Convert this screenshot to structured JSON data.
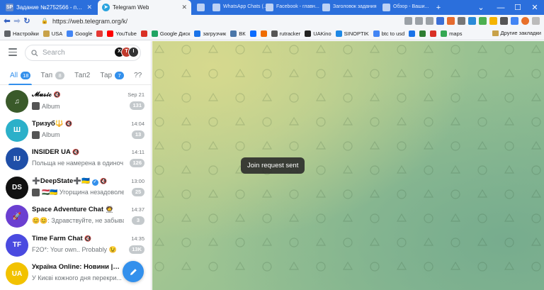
{
  "browser": {
    "tabs": [
      {
        "favicon_text": "SP",
        "title": "Задание №2752566 - просмотр з",
        "active": false
      },
      {
        "favicon_text": "",
        "title": "Telegram Web",
        "active": true
      }
    ],
    "background_tab_titles": [
      "WhatsApp Chats (...)",
      "Facebook - главн...",
      "Заголовок задания",
      "Обзор - Ваши..."
    ],
    "address": {
      "url": "https://web.telegram.org/k/"
    },
    "bookmarks": [
      {
        "label": "Настройки",
        "icon": "gear-icon",
        "color": "#5f6368"
      },
      {
        "label": "USA",
        "icon": "folder-icon",
        "color": "#c8a24a"
      },
      {
        "label": "Google",
        "icon": "google-icon",
        "color": "#4285f4"
      },
      {
        "label": "",
        "icon": "yandex-icon",
        "color": "#e53935"
      },
      {
        "label": "YouTube",
        "icon": "youtube-icon",
        "color": "#ff0000"
      },
      {
        "label": "",
        "icon": "gmail-icon",
        "color": "#d93025"
      },
      {
        "label": "Google Диск",
        "icon": "drive-icon",
        "color": "#1fa463"
      },
      {
        "label": "загрузчик",
        "icon": "download-icon",
        "color": "#1a73e8"
      },
      {
        "label": "ВК",
        "icon": "vk-icon",
        "color": "#4a76a8"
      },
      {
        "label": "",
        "icon": "mail-icon",
        "color": "#0a6cff"
      },
      {
        "label": "",
        "icon": "app-icon",
        "color": "#ef6c00"
      },
      {
        "label": "rutracker",
        "icon": "rutracker-icon",
        "color": "#555555"
      },
      {
        "label": "UAKino",
        "icon": "uakino-icon",
        "color": "#222222"
      },
      {
        "label": "SINOPTIK",
        "icon": "thermometer-icon",
        "color": "#1e88e5"
      },
      {
        "label": "btc to usd",
        "icon": "google-icon",
        "color": "#4285f4"
      },
      {
        "label": "",
        "icon": "p-icon",
        "color": "#1a73e8"
      },
      {
        "label": "",
        "icon": "shield-icon",
        "color": "#2e7d32"
      },
      {
        "label": "",
        "icon": "gmail-icon",
        "color": "#d93025"
      },
      {
        "label": "maps",
        "icon": "maps-icon",
        "color": "#34a853"
      }
    ],
    "other_bookmarks": "Другие закладки"
  },
  "telegram": {
    "search_placeholder": "Search",
    "folders": [
      {
        "label": "All",
        "count": "18",
        "active": true
      },
      {
        "label": "Тап",
        "count": "8",
        "active": false
      },
      {
        "label": "Тап2",
        "count": "",
        "active": false
      },
      {
        "label": "Тар",
        "count": "7",
        "active": false,
        "blue": true
      },
      {
        "label": "??",
        "count": "",
        "active": false
      }
    ],
    "chats": [
      {
        "name": "𝓜𝓾𝓼𝓲𝓬",
        "muted": true,
        "verified": false,
        "preview": "Album",
        "time": "Sep 21",
        "unread": "131",
        "avatar_color": "#3a5a2a",
        "avatar_text": "♫",
        "thumb": true
      },
      {
        "name": "Тризуб🔱",
        "muted": true,
        "verified": false,
        "preview": "Album",
        "time": "14:04",
        "unread": "13",
        "avatar_color": "#2bb0c9",
        "avatar_text": "Ш",
        "thumb": true
      },
      {
        "name": "INSIDER UA",
        "muted": true,
        "verified": false,
        "preview": "Польща не намерена в одиноч...",
        "time": "14:11",
        "unread": "126",
        "avatar_color": "#1f4fa8",
        "avatar_text": "IU",
        "thumb": false
      },
      {
        "name": "➕DeepState➕🇺🇦",
        "muted": true,
        "verified": true,
        "preview": "🇭🇺🇺🇦 Угорщина незадоволе...",
        "time": "13:00",
        "unread": "25",
        "avatar_color": "#111111",
        "avatar_text": "DS",
        "thumb": true
      },
      {
        "name": "Space Adventure Chat 🧑‍🚀",
        "muted": false,
        "verified": false,
        "preview": "😊😊: Здравствуйте, не забываем...",
        "time": "14:37",
        "unread": "3",
        "avatar_color": "#6b3fd1",
        "avatar_text": "🚀",
        "thumb": false
      },
      {
        "name": "Time Farm Chat",
        "muted": true,
        "verified": false,
        "preview": "F2O*: Your own.. Probably 😉",
        "time": "14:35",
        "unread": "13K",
        "avatar_color": "#4a4ae0",
        "avatar_text": "TF",
        "thumb": false
      },
      {
        "name": "Україна Online: Новини | ...",
        "muted": false,
        "verified": true,
        "preview": "У Києві кожного дня перекри...",
        "time": "",
        "unread": "",
        "avatar_color": "#f2c200",
        "avatar_text": "UA",
        "thumb": false
      }
    ],
    "toast": "Join request sent"
  }
}
